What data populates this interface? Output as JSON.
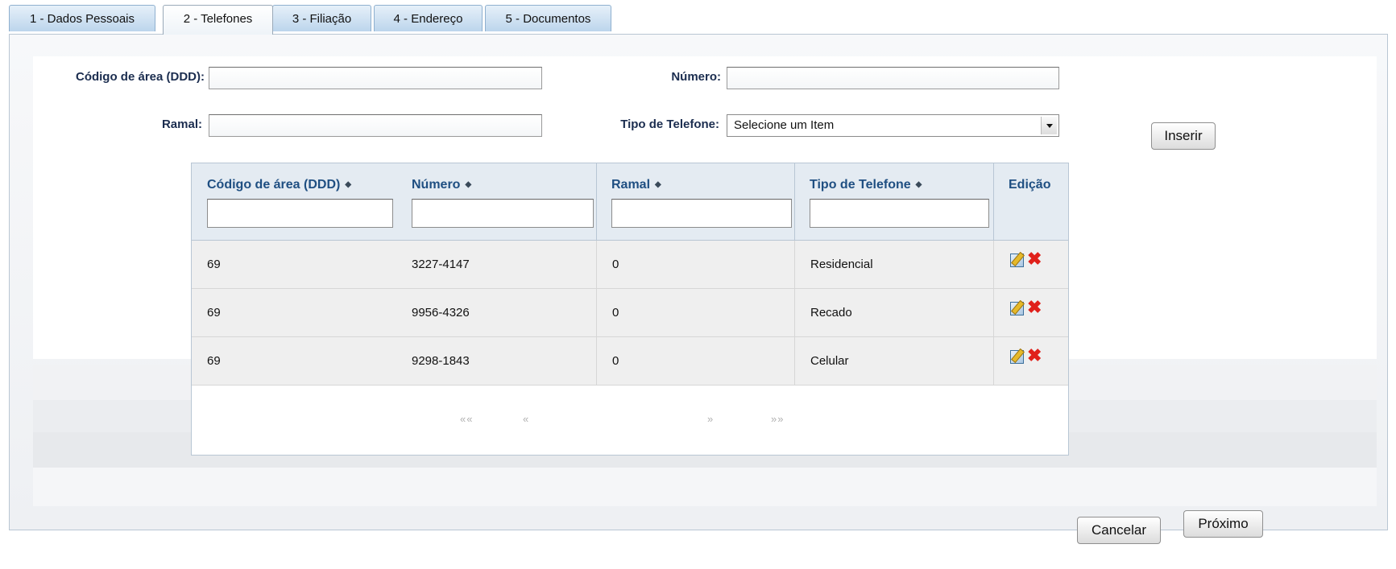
{
  "tabs": [
    {
      "label": "1 - Dados Pessoais",
      "active": false
    },
    {
      "label": "2 - Telefones",
      "active": true
    },
    {
      "label": "3 - Filiação",
      "active": false
    },
    {
      "label": "4 - Endereço",
      "active": false
    },
    {
      "label": "5 - Documentos",
      "active": false
    }
  ],
  "form": {
    "ddd_label": "Código de área (DDD):",
    "ddd_value": "",
    "numero_label": "Número:",
    "numero_value": "",
    "ramal_label": "Ramal:",
    "ramal_value": "",
    "tipo_label": "Tipo de Telefone:",
    "tipo_selected": "Selecione um Item",
    "insert_label": "Inserir"
  },
  "table": {
    "columns": [
      {
        "label": "Código de área (DDD)",
        "sortable": true
      },
      {
        "label": "Número",
        "sortable": true
      },
      {
        "label": "Ramal",
        "sortable": true
      },
      {
        "label": "Tipo de Telefone",
        "sortable": true
      },
      {
        "label": "Edição",
        "sortable": false
      }
    ],
    "sort_glyph": "◆",
    "rows": [
      {
        "ddd": "69",
        "numero": "3227-4147",
        "ramal": "0",
        "tipo": "Residencial"
      },
      {
        "ddd": "69",
        "numero": "9956-4326",
        "ramal": "0",
        "tipo": "Recado"
      },
      {
        "ddd": "69",
        "numero": "9298-1843",
        "ramal": "0",
        "tipo": "Celular"
      }
    ],
    "pager": {
      "first": "««",
      "prev": "«",
      "next": "»",
      "last": "»»"
    }
  },
  "footer": {
    "cancel_label": "Cancelar",
    "next_label": "Próximo"
  },
  "icons": {
    "edit": "edit-icon",
    "delete": "delete-icon",
    "delete_color": "#e0201b",
    "header_text_color": "#1f4f82"
  }
}
